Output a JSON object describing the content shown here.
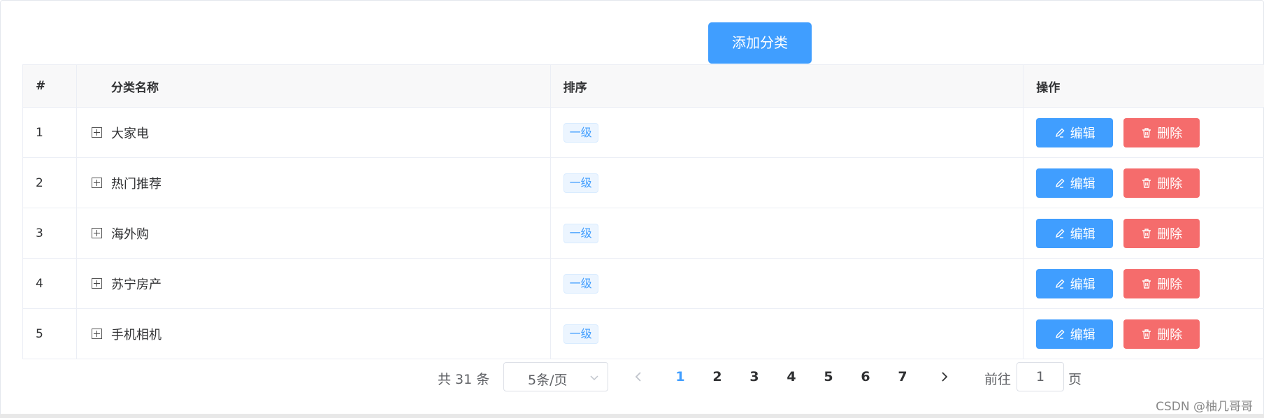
{
  "toolbar": {
    "add_label": "添加分类"
  },
  "table": {
    "headers": {
      "index": "#",
      "name": "分类名称",
      "order": "排序",
      "actions": "操作"
    },
    "rows": [
      {
        "index": "1",
        "name": "大家电",
        "level": "一级"
      },
      {
        "index": "2",
        "name": "热门推荐",
        "level": "一级"
      },
      {
        "index": "3",
        "name": "海外购",
        "level": "一级"
      },
      {
        "index": "4",
        "name": "苏宁房产",
        "level": "一级"
      },
      {
        "index": "5",
        "name": "手机相机",
        "level": "一级"
      }
    ],
    "edit_label": "编辑",
    "delete_label": "删除"
  },
  "pagination": {
    "total_text": "共 31 条",
    "page_size": "5条/页",
    "pages": [
      "1",
      "2",
      "3",
      "4",
      "5",
      "6",
      "7"
    ],
    "current_page": "1",
    "goto_prefix": "前往",
    "goto_value": "1",
    "goto_suffix": "页"
  },
  "watermark": "CSDN @柚几哥哥",
  "colors": {
    "primary": "#409eff",
    "danger": "#f56c6c",
    "border": "#ebeef5",
    "header_bg": "#f8f8f9"
  }
}
